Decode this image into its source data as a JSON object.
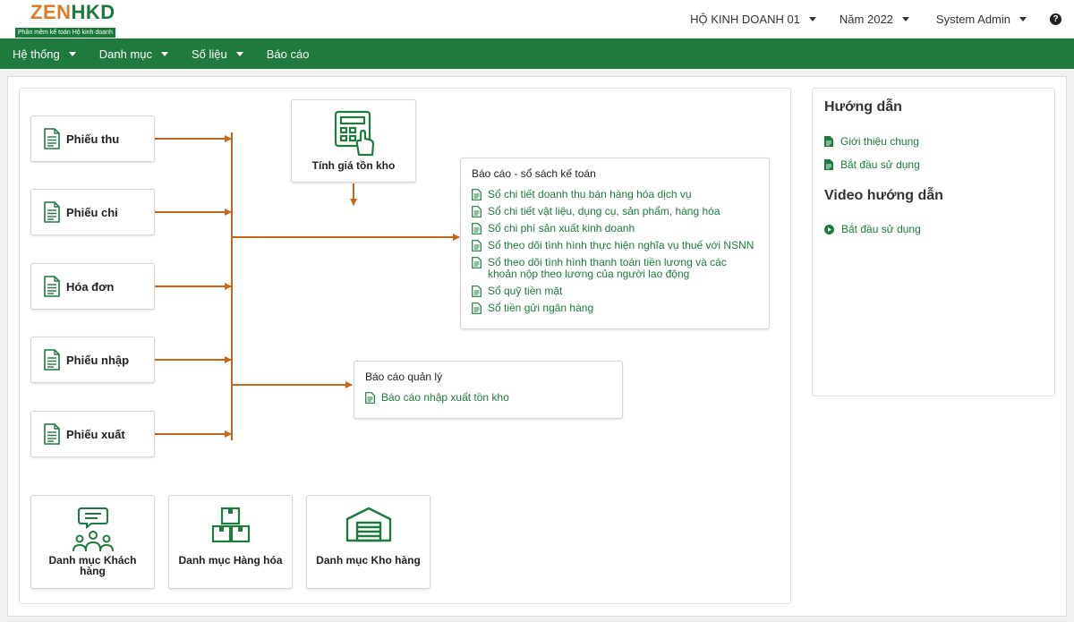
{
  "logo": {
    "part1": "ZEN",
    "part2": "HKD",
    "subtitle": "Phần mềm kế toán Hộ kinh doanh"
  },
  "header": {
    "business": "HỘ KINH DOANH 01",
    "year": "Năm 2022",
    "user": "System Admin",
    "help": "?"
  },
  "nav": {
    "items": [
      {
        "label": "Hệ thống"
      },
      {
        "label": "Danh mục"
      },
      {
        "label": "Số liệu"
      },
      {
        "label": "Báo cáo"
      }
    ]
  },
  "flow": {
    "documents": [
      {
        "label": "Phiếu thu"
      },
      {
        "label": "Phiếu chi"
      },
      {
        "label": "Hóa đơn"
      },
      {
        "label": "Phiếu nhập"
      },
      {
        "label": "Phiếu xuất"
      }
    ],
    "inventory_calc": {
      "label": "Tính giá tồn kho"
    },
    "accounting_reports": {
      "title": "Báo cáo - sổ sách kế toán",
      "links": [
        "Sổ chi tiết doanh thu bán hàng hóa dịch vụ",
        "Sổ chi tiết vật liệu, dụng cụ, sản phẩm, hàng hóa",
        "Sổ chi phí sản xuất kinh doanh",
        "Sổ theo dõi tình hình thực hiện nghĩa vụ thuế với NSNN",
        "Sổ theo dõi tình hình thanh toán tiền lương và các khoản nộp theo lương của người lao động",
        "Sổ quỹ tiền mặt",
        "Sổ tiền gửi ngân hàng"
      ]
    },
    "management_reports": {
      "title": "Báo cáo quản lý",
      "links": [
        "Báo cáo nhập xuất tồn kho"
      ]
    },
    "catalogs": [
      {
        "label": "Danh mục Khách hàng"
      },
      {
        "label": "Danh mục Hàng hóa"
      },
      {
        "label": "Danh mục Kho hàng"
      }
    ]
  },
  "guide": {
    "title": "Hướng dẫn",
    "links": [
      "Giới thiệu chung",
      "Bắt đầu sử dụng"
    ],
    "video_title": "Video hướng dẫn",
    "video_links": [
      "Bắt đầu sử dụng"
    ]
  },
  "colors": {
    "brand_green": "#1e7a3e",
    "logo_orange": "#e07a2a",
    "arrow": "#c8651b"
  }
}
